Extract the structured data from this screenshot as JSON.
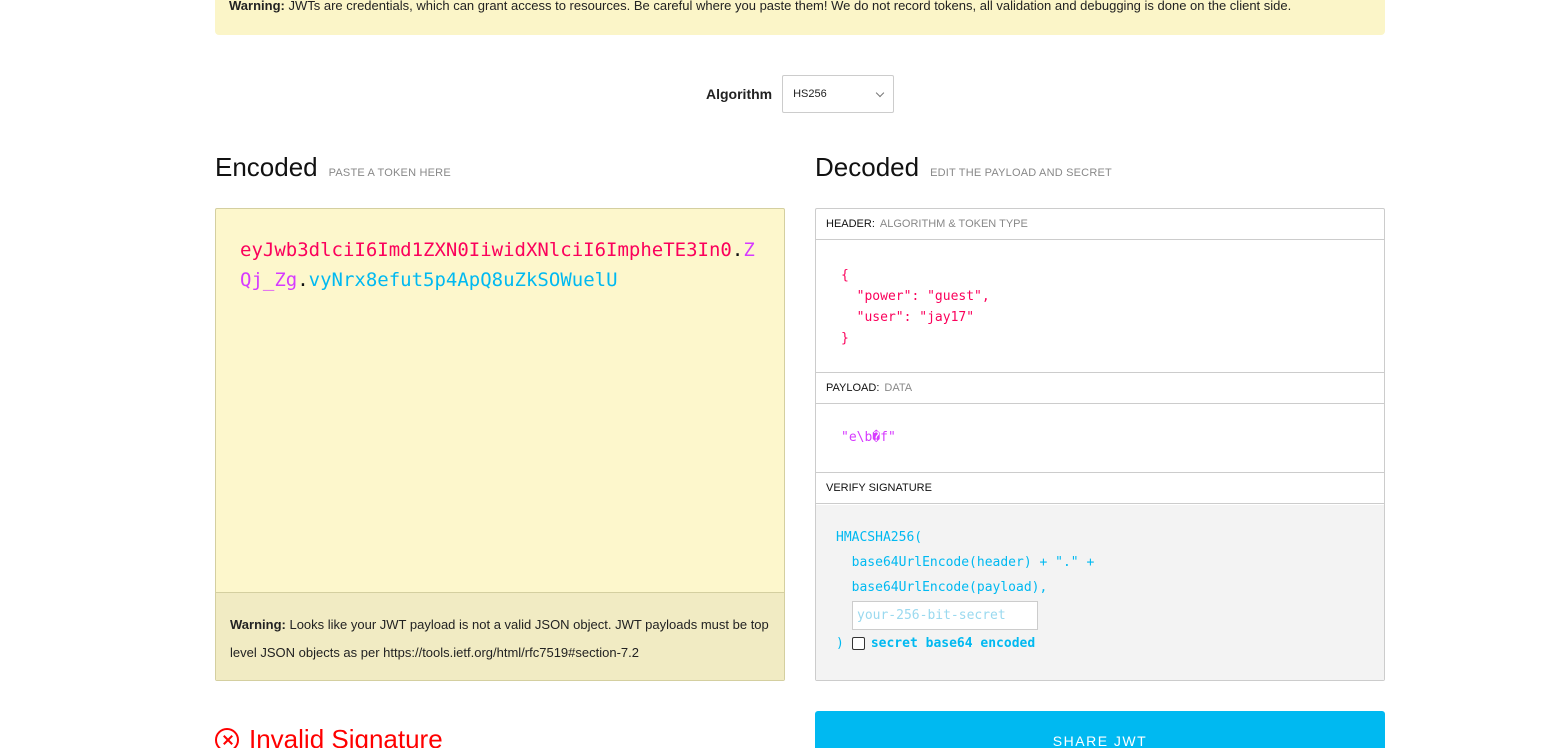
{
  "warning_banner": {
    "label": "Warning:",
    "text": "JWTs are credentials, which can grant access to resources. Be careful where you paste them! We do not record tokens, all validation and debugging is done on the client side."
  },
  "algorithm": {
    "label": "Algorithm",
    "selected": "HS256"
  },
  "encoded": {
    "title": "Encoded",
    "subtitle": "PASTE A TOKEN HERE",
    "token_header": "eyJwb3dlciI6Imd1ZXN0IiwidXNlciI6ImpheTE3In0",
    "token_payload": "ZQj_Zg",
    "token_signature": "vyNrx8efut5p4ApQ8uZkSOWuelU",
    "dot": ".",
    "warning_label": "Warning:",
    "warning_text": "Looks like your JWT payload is not a valid JSON object. JWT payloads must be top level JSON objects as per https://tools.ietf.org/html/rfc7519#section-7.2"
  },
  "decoded": {
    "title": "Decoded",
    "subtitle": "EDIT THE PAYLOAD AND SECRET",
    "header_label": "HEADER:",
    "header_sub": "ALGORITHM & TOKEN TYPE",
    "header_json": "{\n  \"power\": \"guest\",\n  \"user\": \"jay17\"\n}",
    "payload_label": "PAYLOAD:",
    "payload_sub": "DATA",
    "payload_value": "\"e\\b�f\"",
    "verify_label": "VERIFY SIGNATURE",
    "verify_code": "HMACSHA256(\n  base64UrlEncode(header) + \".\" +\n  base64UrlEncode(payload),",
    "secret_placeholder": "your-256-bit-secret",
    "close_paren": ")",
    "secret_b64_label": "secret base64 encoded",
    "secret_b64_checked": false
  },
  "status": {
    "text": "Invalid Signature",
    "color": "#ff0000"
  },
  "share_button": {
    "label": "SHARE JWT",
    "color": "#00b9f1"
  }
}
